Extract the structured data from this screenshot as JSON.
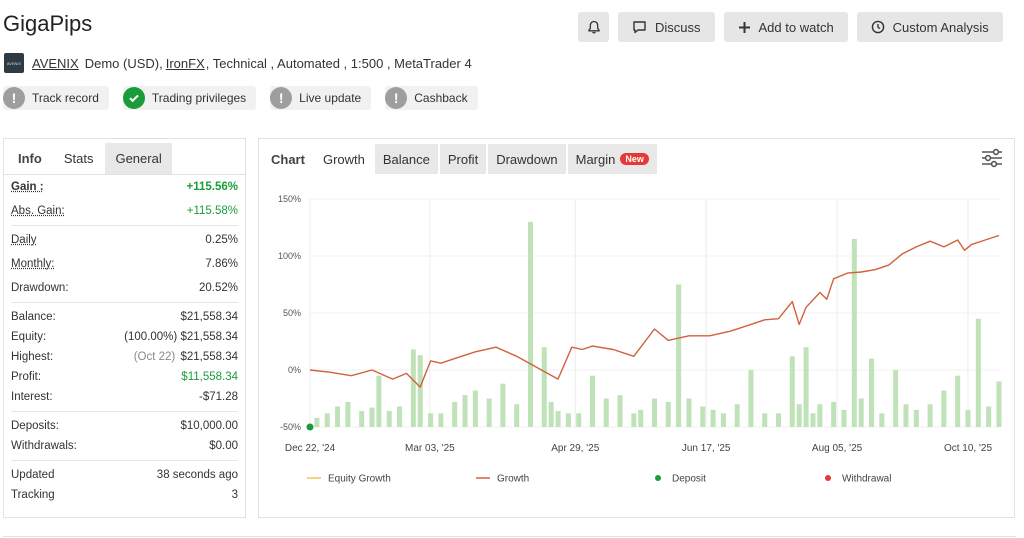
{
  "header": {
    "title": "GigaPips",
    "logo_text": "AVENIX",
    "subtitle": {
      "name": "AVENIX",
      "account": "Demo (USD),",
      "broker": "IronFX",
      "rest": ", Technical , Automated , 1:500 , MetaTrader 4"
    }
  },
  "actions": {
    "bell_icon": "bell-icon",
    "discuss": "Discuss",
    "add_watch": "Add to watch",
    "custom_analysis": "Custom Analysis"
  },
  "badges": [
    {
      "label": "Track record",
      "state": "grey"
    },
    {
      "label": "Trading privileges",
      "state": "green"
    },
    {
      "label": "Live update",
      "state": "grey"
    },
    {
      "label": "Cashback",
      "state": "grey"
    }
  ],
  "stats": {
    "tabs": [
      "Info",
      "Stats",
      "General"
    ],
    "gain_label": "Gain :",
    "gain": "+115.56%",
    "abs_gain_label": "Abs. Gain:",
    "abs_gain": "+115.58%",
    "daily_label": "Daily",
    "daily": "0.25%",
    "monthly_label": "Monthly:",
    "monthly": "7.86%",
    "drawdown_label": "Drawdown:",
    "drawdown": "20.52%",
    "balance_label": "Balance:",
    "balance": "$21,558.34",
    "equity_label": "Equity:",
    "equity_pct": "(100.00%)",
    "equity": "$21,558.34",
    "highest_label": "Highest:",
    "highest_date": "(Oct 22)",
    "highest": "$21,558.34",
    "profit_label": "Profit:",
    "profit": "$11,558.34",
    "interest_label": "Interest:",
    "interest": "-$71.28",
    "deposits_label": "Deposits:",
    "deposits": "$10,000.00",
    "withdrawals_label": "Withdrawals:",
    "withdrawals": "$0.00",
    "updated_label": "Updated",
    "updated": "38 seconds ago",
    "tracking_label": "Tracking",
    "tracking": "3"
  },
  "chart_tabs": {
    "chart": "Chart",
    "growth": "Growth",
    "balance": "Balance",
    "profit": "Profit",
    "drawdown": "Drawdown",
    "margin": "Margin",
    "new": "New"
  },
  "colors": {
    "growth_line": "#d0623d",
    "equity_line": "#f2c35a",
    "bars": "#bfe2b8",
    "deposit": "#1a9c3b",
    "withdrawal": "#e53935"
  },
  "chart_data": {
    "type": "line",
    "ylim": [
      -50,
      150
    ],
    "y_ticks": [
      "150%",
      "100%",
      "50%",
      "0%",
      "-50%"
    ],
    "x_ticks": [
      "Dec 22, '24",
      "Mar 03, '25",
      "Apr 29, '25",
      "Jun 17, '25",
      "Aug 05, '25",
      "Oct 10, '25"
    ],
    "legend": [
      "Equity Growth",
      "Growth",
      "Deposit",
      "Withdrawal"
    ],
    "growth": {
      "x_frac": [
        0,
        0.03,
        0.06,
        0.09,
        0.12,
        0.14,
        0.16,
        0.175,
        0.19,
        0.21,
        0.24,
        0.27,
        0.3,
        0.33,
        0.36,
        0.38,
        0.395,
        0.41,
        0.44,
        0.47,
        0.5,
        0.52,
        0.535,
        0.55,
        0.58,
        0.61,
        0.64,
        0.66,
        0.68,
        0.7,
        0.71,
        0.72,
        0.74,
        0.75,
        0.76,
        0.78,
        0.8,
        0.82,
        0.84,
        0.86,
        0.88,
        0.9,
        0.92,
        0.94,
        0.95,
        0.96,
        0.98,
        1.0
      ],
      "y": [
        0,
        -2,
        -5,
        0,
        -8,
        -3,
        -15,
        8,
        6,
        10,
        16,
        20,
        12,
        2,
        -8,
        20,
        18,
        21,
        18,
        12,
        36,
        26,
        28,
        30,
        30,
        34,
        40,
        44,
        45,
        60,
        40,
        55,
        68,
        62,
        80,
        85,
        86,
        88,
        92,
        102,
        108,
        113,
        108,
        114,
        105,
        110,
        114,
        118
      ]
    },
    "bars": {
      "x_frac": [
        0.01,
        0.025,
        0.04,
        0.055,
        0.075,
        0.09,
        0.1,
        0.115,
        0.13,
        0.15,
        0.16,
        0.175,
        0.19,
        0.21,
        0.225,
        0.24,
        0.26,
        0.28,
        0.3,
        0.32,
        0.34,
        0.35,
        0.36,
        0.375,
        0.39,
        0.41,
        0.43,
        0.45,
        0.47,
        0.48,
        0.5,
        0.52,
        0.535,
        0.55,
        0.57,
        0.585,
        0.6,
        0.62,
        0.64,
        0.66,
        0.68,
        0.7,
        0.71,
        0.72,
        0.73,
        0.74,
        0.76,
        0.775,
        0.79,
        0.8,
        0.815,
        0.83,
        0.85,
        0.865,
        0.88,
        0.9,
        0.92,
        0.94,
        0.955,
        0.97,
        0.985,
        1.0
      ],
      "y": [
        -42,
        -38,
        -32,
        -28,
        -36,
        -33,
        -5,
        -36,
        -32,
        18,
        13,
        -38,
        -38,
        -28,
        -22,
        -18,
        -25,
        -12,
        -30,
        130,
        20,
        -28,
        -36,
        -38,
        -38,
        -5,
        -25,
        -22,
        -38,
        -35,
        -25,
        -28,
        75,
        -25,
        -32,
        -35,
        -38,
        -30,
        0,
        -38,
        -38,
        12,
        -30,
        20,
        -38,
        -30,
        -28,
        -35,
        115,
        -25,
        10,
        -38,
        0,
        -30,
        -35,
        -30,
        -18,
        -5,
        -35,
        45,
        -32,
        -10
      ],
      "baseline": -50
    },
    "deposit_point": {
      "x_frac": 0,
      "y": -50
    }
  }
}
